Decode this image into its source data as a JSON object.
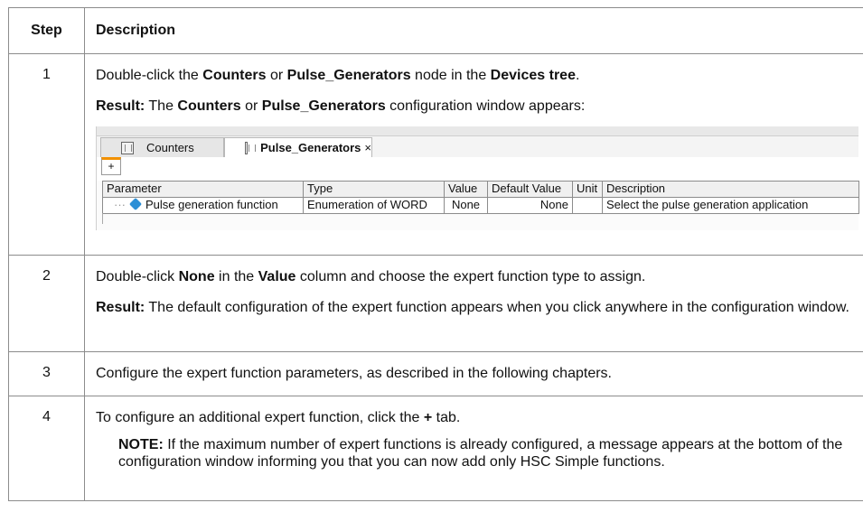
{
  "header": {
    "step": "Step",
    "description": "Description"
  },
  "step1": {
    "number": "1",
    "line1": {
      "pre": "Double-click the ",
      "counters": "Counters",
      "or": " or ",
      "pulse": "Pulse_Generators",
      "mid": " node in the ",
      "devices": "Devices tree",
      "end": "."
    },
    "result": {
      "label": "Result:",
      "pre": " The ",
      "counters": "Counters",
      "or": " or ",
      "pulse": "Pulse_Generators",
      "end": " configuration window appears:"
    },
    "screenshot": {
      "tabs": [
        {
          "label": "Counters"
        },
        {
          "label": "Pulse_Generators",
          "close": "×"
        }
      ],
      "plus_tab": "+",
      "columns": [
        "Parameter",
        "Type",
        "Value",
        "Default Value",
        "Unit",
        "Description"
      ],
      "row": {
        "parameter": "Pulse generation function",
        "type": "Enumeration of WORD",
        "value": "None",
        "default_value": "None",
        "unit": "",
        "description": "Select the pulse generation application"
      }
    }
  },
  "step2": {
    "number": "2",
    "line1": {
      "pre": "Double-click ",
      "none": "None",
      "mid": " in the ",
      "value": "Value",
      "end": " column and choose the expert function type to assign."
    },
    "result": {
      "label": "Result:",
      "text": " The default configuration of the expert function appears when you click anywhere in the configuration window."
    }
  },
  "step3": {
    "number": "3",
    "text": "Configure the expert function parameters, as described in the following chapters."
  },
  "step4": {
    "number": "4",
    "line1": {
      "pre": "To configure an additional expert function, click the ",
      "plus": "+",
      "end": " tab."
    },
    "note": {
      "label": "NOTE:",
      "text": " If the maximum number of expert functions is already configured, a message appears at the bottom of the configuration window informing you that you can now add only HSC Simple functions."
    }
  }
}
